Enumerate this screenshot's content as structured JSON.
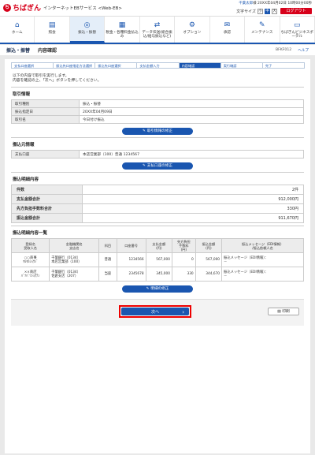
{
  "header": {
    "logo_mark": "ち",
    "logo_name": "ちばぎん",
    "service_name": "インターネットEBサービス <Web-EB>",
    "user_name": "千葉太郎",
    "user_suffix": "様",
    "last_login": "20XX年04月02日 10時00分00秒",
    "font_size_label": "文字サイズ",
    "size_small": "小",
    "size_medium": "中",
    "size_large": "大",
    "logout": "ログアウト"
  },
  "nav": [
    {
      "icon": "⌂",
      "label": "ホーム"
    },
    {
      "icon": "▤",
      "label": "照会"
    },
    {
      "icon": "◎",
      "label": "振込・振替"
    },
    {
      "icon": "▦",
      "label": "税金・各種料金払込み"
    },
    {
      "icon": "⇄",
      "label": "データ伝送(総合振込/給与振込など)"
    },
    {
      "icon": "⚙",
      "label": "オプション"
    },
    {
      "icon": "✉",
      "label": "承認"
    },
    {
      "icon": "✎",
      "label": "メンテナンス"
    },
    {
      "icon": "▭",
      "label": "ちばぎんビジネスポータル"
    }
  ],
  "title": {
    "section": "振込・振替",
    "page": "内容確認",
    "code": "BFKF012",
    "help": "ヘルプ"
  },
  "steps": [
    "支払口座選択",
    "振込先口座指定方法選択",
    "振込先口座選択",
    "支払金額入力",
    "内容確認",
    "実行確認",
    "完了"
  ],
  "message": [
    "以下の内容で取引を実行します。",
    "内容を確認の上、「次へ」ボタンを押してください。"
  ],
  "transaction_info": {
    "heading": "取引情報",
    "rows": [
      {
        "label": "取引種別",
        "value": "振込・振替"
      },
      {
        "label": "振込指定日",
        "value": "20XX年04月09日"
      },
      {
        "label": "取引名",
        "value": "今日付け振込"
      }
    ],
    "button": "取引情報の修正"
  },
  "source_info": {
    "heading": "振込元情報",
    "rows": [
      {
        "label": "支払口座",
        "value": "本店営業部（100）普通 1234567"
      }
    ],
    "button": "支払口座の修正"
  },
  "summary": {
    "heading": "振込明細内容",
    "rows": [
      {
        "label": "件数",
        "value": "2件"
      },
      {
        "label": "支払金額合計",
        "value": "912,000円"
      },
      {
        "label": "先方負担手数料合計",
        "value": "330円"
      },
      {
        "label": "振込金額合計",
        "value": "911,670円"
      }
    ]
  },
  "details": {
    "heading": "振込明細内容一覧",
    "columns": [
      "登録名\n受取人名",
      "金融機関名\n支店名",
      "科目",
      "口座番号",
      "支払金額\n(円)",
      "先方負担\n手数料\n(円)",
      "振込金額\n(円)",
      "振込メッセージ（EDI情報）\n/振込依頼人名"
    ],
    "rows": [
      {
        "reg": "○○商事",
        "payee": "ﾏﾙﾏﾙｼｮｳｼﾞ",
        "bank": "千葉銀行（0134）",
        "branch": "本店営業部（100）",
        "type": "普通",
        "account": "1234566",
        "pay": "567,000",
        "fee": "0",
        "amount": "567,000",
        "msg": "振込メッセージ（EDI情報）：",
        "sender": "－"
      },
      {
        "reg": "××商店",
        "payee": "ﾊﾞﾂﾊﾞﾂｼｮｳﾃﾝ",
        "bank": "千葉銀行（0134）",
        "branch": "佐倉支店（207）",
        "type": "当座",
        "account": "2345678",
        "pay": "345,000",
        "fee": "330",
        "amount": "344,670",
        "msg": "振込メッセージ（EDI情報）：",
        "sender": "－"
      }
    ],
    "button": "明細の修正"
  },
  "footer": {
    "next": "次へ",
    "print": "印刷"
  }
}
